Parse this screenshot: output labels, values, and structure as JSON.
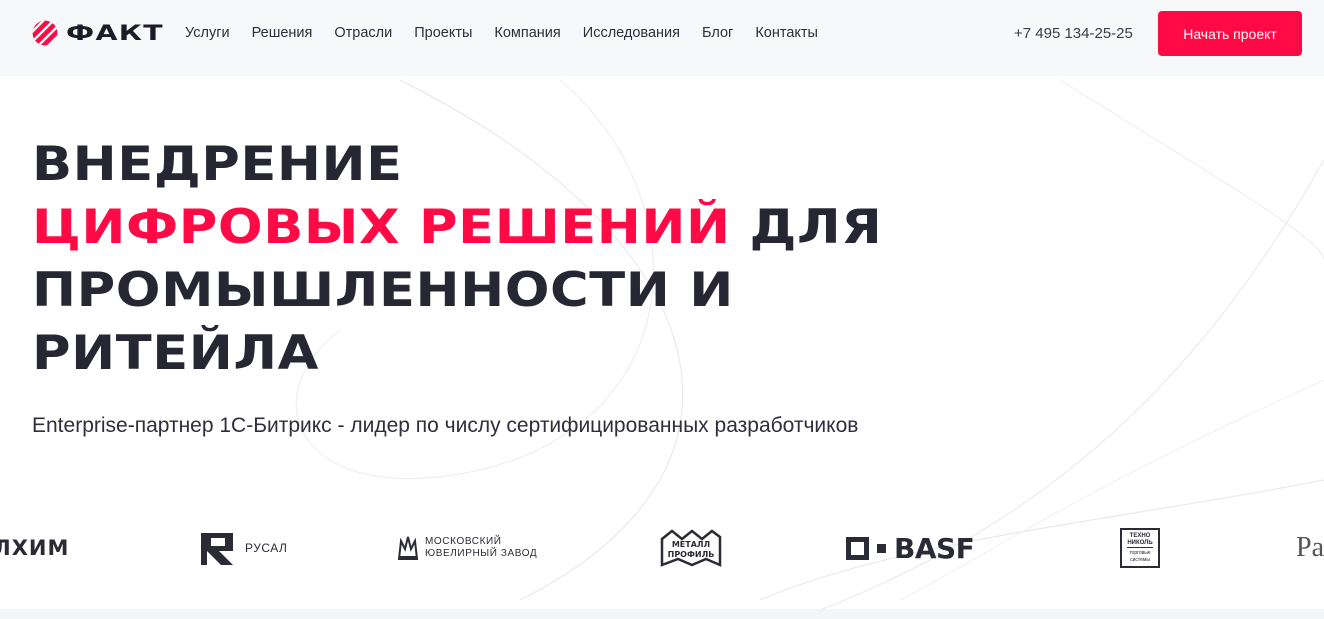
{
  "brand": {
    "name": "ФАКТ",
    "accent": "#ff0a45",
    "dark": "#262733"
  },
  "nav": [
    {
      "label": "Услуги"
    },
    {
      "label": "Решения"
    },
    {
      "label": "Отрасли"
    },
    {
      "label": "Проекты"
    },
    {
      "label": "Компания"
    },
    {
      "label": "Исследования"
    },
    {
      "label": "Блог"
    },
    {
      "label": "Контакты"
    }
  ],
  "header": {
    "phone": "+7 495 134-25-25",
    "cta_label": "Начать проект"
  },
  "hero": {
    "line1": "ВНЕДРЕНИЕ",
    "line2_highlight": "ЦИФРОВЫХ РЕШЕНИЙ",
    "line2_rest": " ДЛЯ",
    "line3": "ПРОМЫШЛЕННОСТИ И",
    "line4": "РИТЕЙЛА",
    "subtitle": "Enterprise-партнер 1С-Битрикс - лидер по числу сертифицированных разработчиков"
  },
  "clients": {
    "alhim": "АЛХИМ",
    "rusal": "РУСАЛ",
    "mjz_line1": "Московский",
    "mjz_line2": "ювелирный завод",
    "metallprofil_line1": "МЕТАЛЛ",
    "metallprofil_line2": "ПРОФИЛЬ",
    "basf": "BASF",
    "tn_line1": "ТЕХНО",
    "tn_line2": "НИКОЛЬ",
    "tn_line3": "торговые системы",
    "partial": "Pa"
  }
}
